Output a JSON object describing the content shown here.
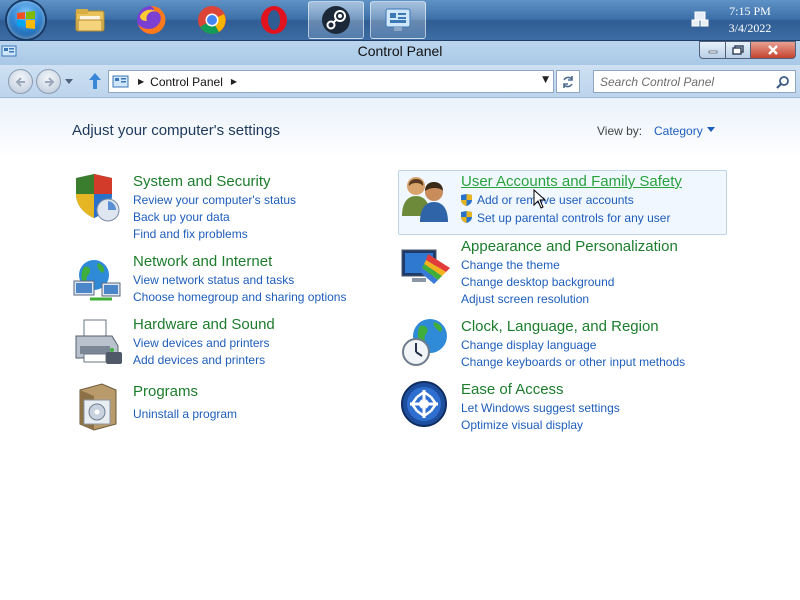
{
  "window": {
    "title": "Control Panel"
  },
  "taskbar": {
    "apps": [
      "file-explorer",
      "firefox",
      "chrome",
      "opera",
      "steam",
      "control-panel"
    ],
    "time": "7:15 PM",
    "date": "3/4/2022"
  },
  "navigation": {
    "address": "Control Panel",
    "search_placeholder": "Search Control Panel"
  },
  "content": {
    "heading": "Adjust your computer's settings",
    "view_by_label": "View by:",
    "view_by_value": "Category",
    "categories": [
      {
        "title": "System and Security",
        "links": [
          "Review your computer's status",
          "Back up your data",
          "Find and fix problems"
        ]
      },
      {
        "title": "Network and Internet",
        "links": [
          "View network status and tasks",
          "Choose homegroup and sharing options"
        ]
      },
      {
        "title": "Hardware and Sound",
        "links": [
          "View devices and printers",
          "Add devices and printers"
        ]
      },
      {
        "title": "Programs",
        "links": [
          "Uninstall a program"
        ]
      },
      {
        "title": "User Accounts and Family Safety",
        "links": [
          "Add or remove user accounts",
          "Set up parental controls for any user"
        ]
      },
      {
        "title": "Appearance and Personalization",
        "links": [
          "Change the theme",
          "Change desktop background",
          "Adjust screen resolution"
        ]
      },
      {
        "title": "Clock, Language, and Region",
        "links": [
          "Change display language",
          "Change keyboards or other input methods"
        ]
      },
      {
        "title": "Ease of Access",
        "links": [
          "Let Windows suggest settings",
          "Optimize visual display"
        ]
      }
    ]
  },
  "colors": {
    "category_title": "#1c7d2c",
    "link": "#1e5ebb",
    "heading": "#1e395b"
  }
}
